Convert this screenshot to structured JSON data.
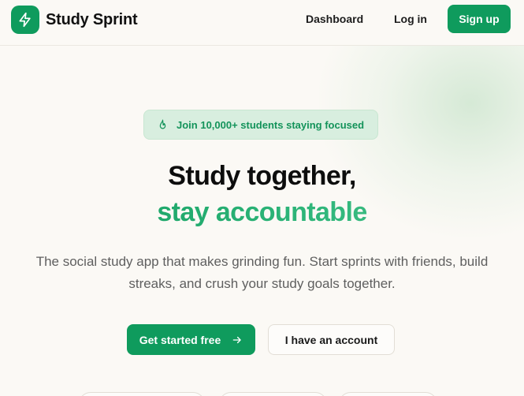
{
  "brand": {
    "name": "Study Sprint",
    "logo_icon": "lightning-bolt-icon",
    "accent": "#0f9b5d"
  },
  "nav": {
    "dashboard": "Dashboard",
    "login": "Log in",
    "signup": "Sign up"
  },
  "hero": {
    "badge_icon": "flame-icon",
    "badge_text": "Join 10,000+ students staying focused",
    "title_line1": "Study together,",
    "title_line2": "stay accountable",
    "subtitle_line1": "The social study app that makes grinding fun. Start sprints with friends, build",
    "subtitle_line2": "streaks, and crush your study goals together.",
    "primary_cta": "Get started free",
    "primary_cta_icon": "arrow-right-icon",
    "secondary_cta": "I have an account"
  }
}
